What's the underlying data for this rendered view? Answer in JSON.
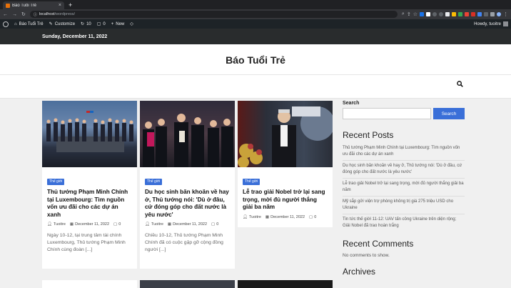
{
  "browser": {
    "tab_title": "Báo Tuổi Trẻ",
    "url_host": "localhost",
    "url_path": "/wordpress/"
  },
  "adminbar": {
    "site_name": "Báo Tuổi Trẻ",
    "customize": "Customize",
    "updates_count": "10",
    "comments_count": "0",
    "new_label": "New",
    "howdy": "Howdy, tuoitre"
  },
  "datebar": {
    "date": "Sunday, December 11, 2022"
  },
  "site": {
    "title": "Báo Tuổi Trẻ"
  },
  "posts": [
    {
      "category": "Thế giới",
      "title": "Thủ tướng Phạm Minh Chính tại Luxembourg: Tìm nguồn vốn ưu đãi cho các dự án xanh",
      "author": "Tuoitre",
      "date": "December 11, 2022",
      "comments": "0",
      "excerpt": "Ngày 10-12, tại trung tâm tài chính Luxembourg, Thủ tướng Phạm Minh Chính cùng đoàn [...]"
    },
    {
      "category": "Thế giới",
      "title": "Du học sinh băn khoăn về hay ở, Thủ tướng nói: 'Dù ở đâu, cứ đóng góp cho đất nước là yêu nước'",
      "author": "Tuoitre",
      "date": "December 11, 2022",
      "comments": "0",
      "excerpt": "Chiều 10-12, Thủ tướng Phạm Minh Chính đã có cuộc gặp gỡ cộng đồng người [...]"
    },
    {
      "category": "Thế giới",
      "title": "Lễ trao giải Nobel trở lại sang trọng, mời đủ người thắng giải ba năm",
      "author": "Tuoitre",
      "date": "December 11, 2022",
      "comments": "0",
      "excerpt": ""
    }
  ],
  "sidebar": {
    "search_heading": "Search",
    "search_button": "Search",
    "recent_posts_title": "Recent Posts",
    "recent_posts": [
      "Thủ tướng Phạm Minh Chính tại Luxembourg: Tìm nguồn vốn ưu đãi cho các dự án xanh",
      "Du học sinh băn khoăn về hay ở, Thủ tướng nói: 'Dù ở đâu, cứ đóng góp cho đất nước là yêu nước'",
      "Lễ trao giải Nobel trở lại sang trọng, mời đủ người thắng giải ba năm",
      "Mỹ sắp gửi viện trợ phòng không trị giá 275 triệu USD cho Ukraine",
      "Tin tức thế giới 11-12: UAV tấn công Ukraine trên diện rộng; Giải Nobel đã trao hoàn trắng"
    ],
    "recent_comments_title": "Recent Comments",
    "no_comments": "No comments to show.",
    "archives_title": "Archives"
  },
  "colors": {
    "accent": "#3a6fd8",
    "admin_bar": "#1d2327",
    "date_bar": "#292c2d"
  }
}
